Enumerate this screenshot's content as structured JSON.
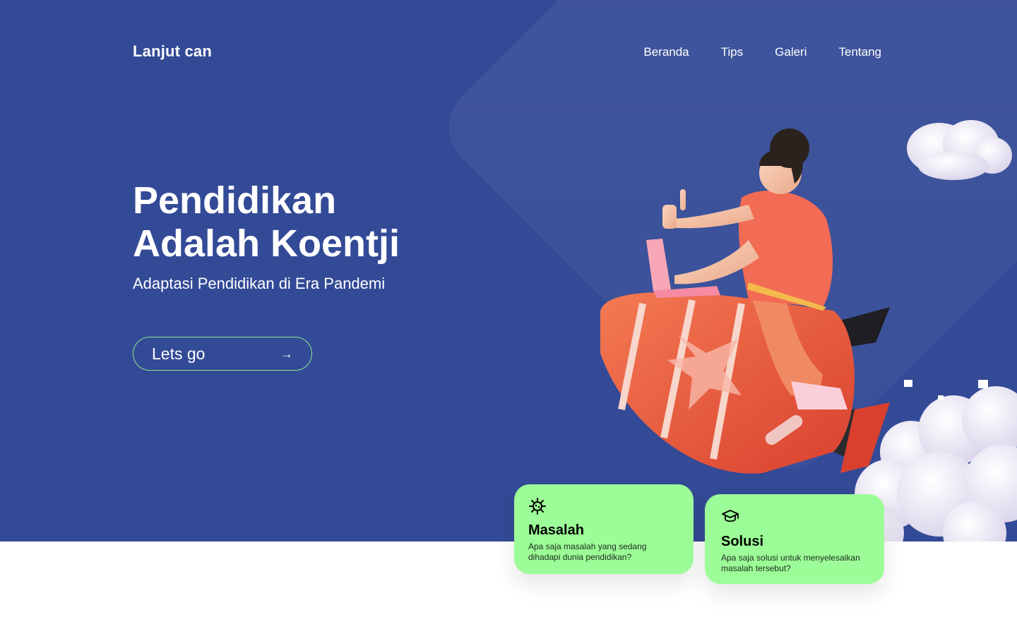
{
  "brand": {
    "name": "Lanjut can"
  },
  "nav": {
    "items": [
      {
        "label": "Beranda"
      },
      {
        "label": "Tips"
      },
      {
        "label": "Galeri"
      },
      {
        "label": "Tentang"
      }
    ]
  },
  "hero": {
    "title_line1": "Pendidikan",
    "title_line2": "Adalah Koentji",
    "subtitle": "Adaptasi Pendidikan di Era Pandemi",
    "cta_label": "Lets go",
    "cta_arrow": "→"
  },
  "cards": [
    {
      "icon": "virus-icon",
      "title": "Masalah",
      "description": "Apa saja masalah yang sedang dihadapi dunia pendidikan?"
    },
    {
      "icon": "graduation-cap-icon",
      "title": "Solusi",
      "description": "Apa saja solusi untuk menyelesaikan masalah tersebut?"
    }
  ],
  "colors": {
    "hero_bg": "#334a96",
    "accent_green": "#9cfc97",
    "cta_border": "#8ee68e",
    "rocket": "#ea5a3c",
    "shirt": "#f26b54"
  }
}
